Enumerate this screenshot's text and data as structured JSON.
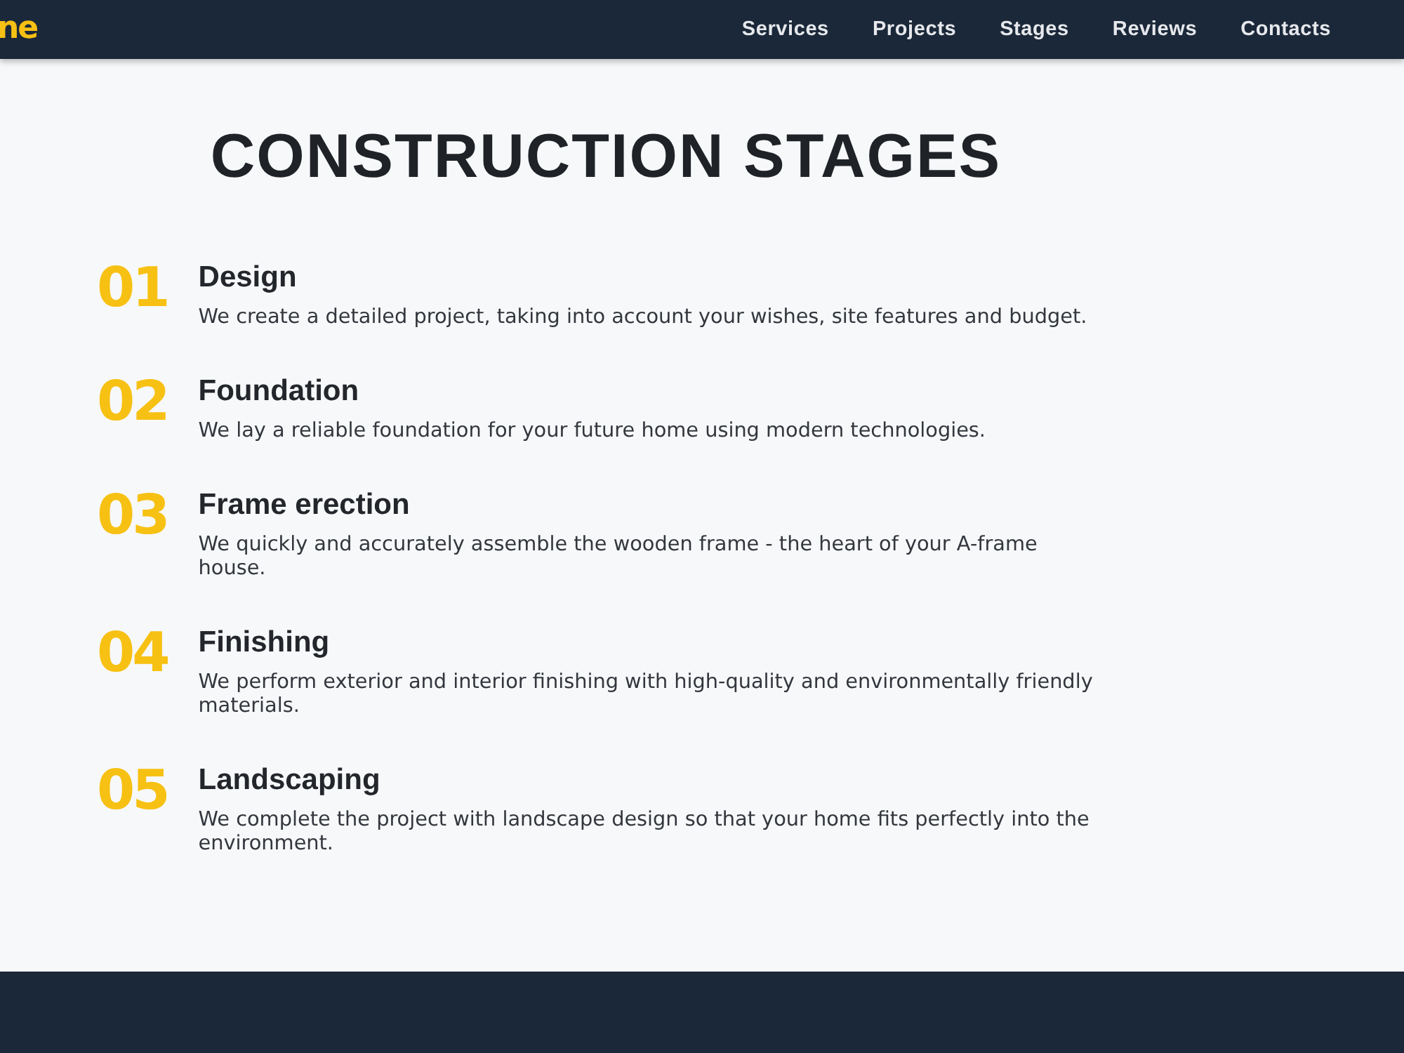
{
  "header": {
    "logo": "ne",
    "nav": [
      "Services",
      "Projects",
      "Stages",
      "Reviews",
      "Contacts"
    ]
  },
  "section": {
    "title": "CONSTRUCTION STAGES",
    "stages": [
      {
        "number": "01",
        "title": "Design",
        "description": "We create a detailed project, taking into account your wishes, site features and budget."
      },
      {
        "number": "02",
        "title": "Foundation",
        "description": "We lay a reliable foundation for your future home using modern technologies."
      },
      {
        "number": "03",
        "title": "Frame erection",
        "description": "We quickly and accurately assemble the wooden frame - the heart of your A-frame house."
      },
      {
        "number": "04",
        "title": "Finishing",
        "description": "We perform exterior and interior finishing with high-quality and environmentally friendly materials."
      },
      {
        "number": "05",
        "title": "Landscaping",
        "description": "We complete the project with landscape design so that your home fits perfectly into the environment."
      }
    ]
  }
}
